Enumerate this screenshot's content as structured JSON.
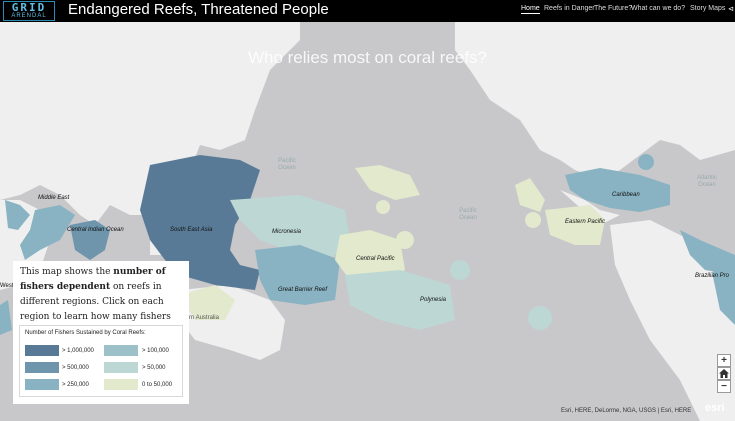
{
  "header": {
    "logo_text": "GRID",
    "logo_subtext": "ARENDAL",
    "title": "Endangered Reefs, Threatened People",
    "nav": [
      "Home",
      "Reefs in Danger",
      "The Future?",
      "What can we do?",
      "Story Maps"
    ]
  },
  "map": {
    "subtitle": "Who relies most on coral reefs?",
    "regions": [
      "Middle East",
      "Central Indian Ocean",
      "South East Asia",
      "Micronesia",
      "Great Barrier Reef",
      "Central Pacific",
      "Polynesia",
      "Eastern Pacific",
      "Caribbean",
      "Brazilian Pro",
      "Western Australia",
      "Western"
    ],
    "ocean_labels": [
      "Pacific Ocean",
      "Pacific Ocean",
      "Atlantic Ocean"
    ],
    "attribution": "Esri, HERE, DeLorme, NGA, USGS | Esri, HERE",
    "esri_logo": "esri"
  },
  "info": {
    "text_before": "This map shows the ",
    "text_bold": "number of fishers dependent",
    "text_after": " on reefs in different regions. Click on each region to learn how many fishers are dependent."
  },
  "legend": {
    "title": "Number of Fishers Sustained by Coral Reefs:",
    "items": [
      {
        "label": "> 1,000,000",
        "color": "#587a96"
      },
      {
        "label": "> 100,000",
        "color": "#9cc1c8"
      },
      {
        "label": "> 500,000",
        "color": "#6e95ab"
      },
      {
        "label": "> 50,000",
        "color": "#bcd7d4"
      },
      {
        "label": "> 250,000",
        "color": "#89b3c2"
      },
      {
        "label": "0 to 50,000",
        "color": "#e2e9cc"
      }
    ]
  },
  "controls": {
    "zoom_in": "+",
    "home_icon": "home-icon",
    "zoom_out": "−"
  }
}
